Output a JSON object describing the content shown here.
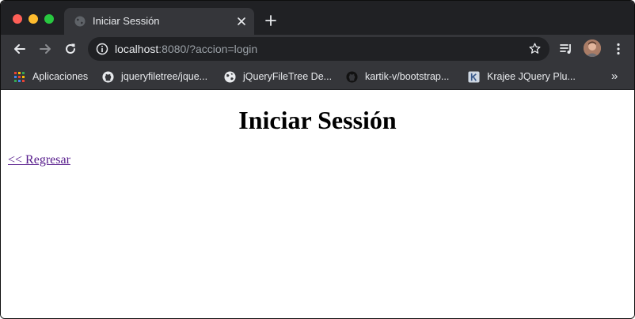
{
  "browser": {
    "tab": {
      "title": "Iniciar Sessión"
    },
    "address_bar": {
      "host": "localhost",
      "rest": ":8080/?accion=login"
    }
  },
  "bookmarks": [
    {
      "label": "Aplicaciones",
      "icon": "apps-grid-icon"
    },
    {
      "label": "jqueryfiletree/jque...",
      "icon": "github-icon"
    },
    {
      "label": "jQueryFileTree De...",
      "icon": "globe-icon"
    },
    {
      "label": "kartik-v/bootstrap...",
      "icon": "github-icon"
    },
    {
      "label": "Krajee JQuery Plu...",
      "icon": "krajee-icon"
    }
  ],
  "bookmarks_more": "»",
  "page": {
    "title": "Iniciar Sessión",
    "back_link": "<< Regresar"
  },
  "colors": {
    "chrome_dark": "#202124",
    "chrome_toolbar": "#35363a",
    "visited_link": "#551a8b"
  }
}
